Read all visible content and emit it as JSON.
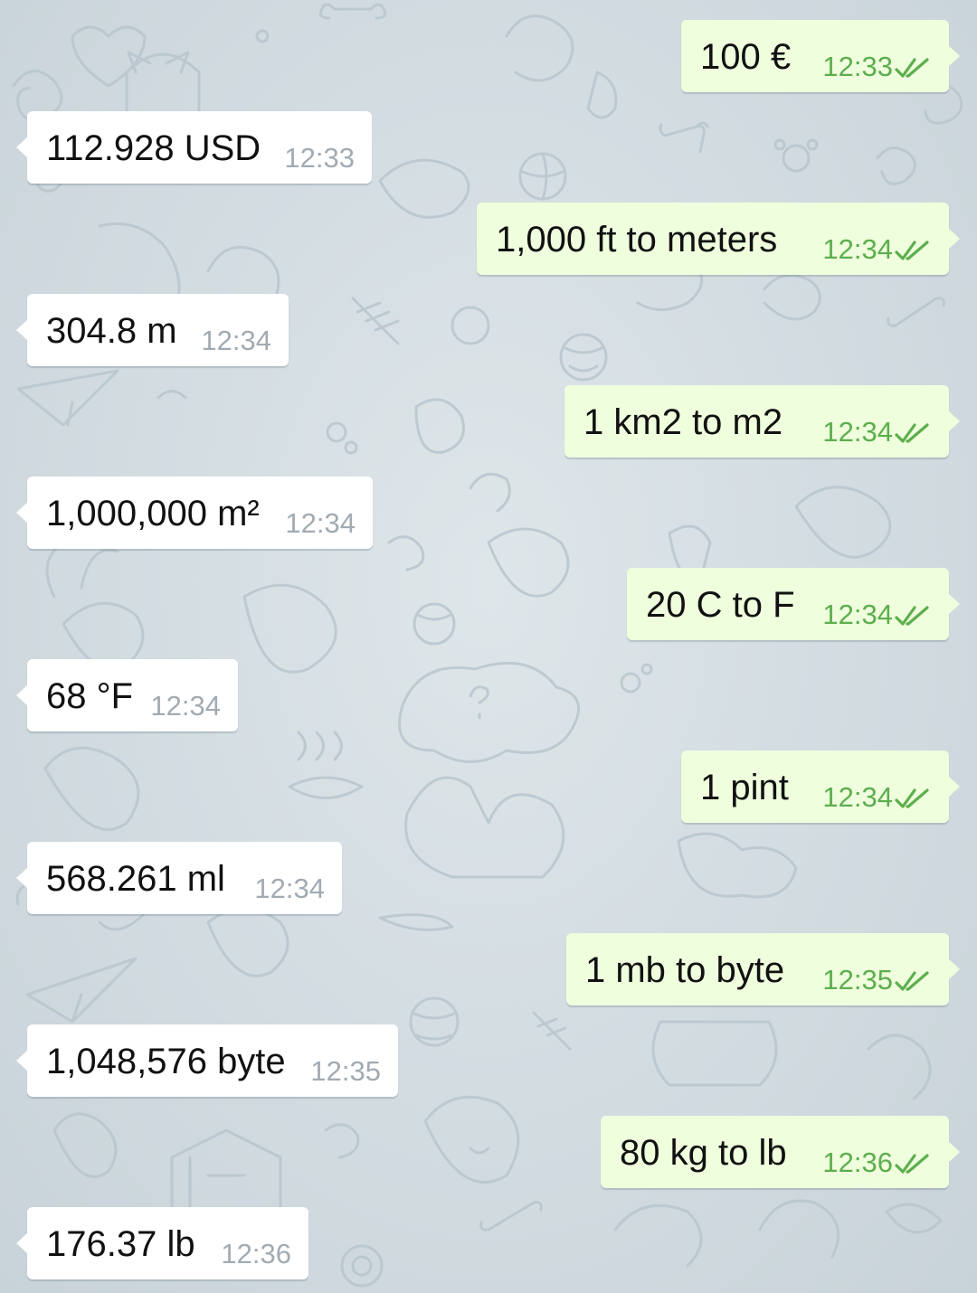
{
  "chat": {
    "messages": [
      {
        "direction": "out",
        "text": "100 €",
        "time": "12:33",
        "status_icon": "double-check-icon"
      },
      {
        "direction": "in",
        "text": "112.928 USD",
        "time": "12:33"
      },
      {
        "direction": "out",
        "text": "1,000 ft to meters",
        "time": "12:34",
        "status_icon": "double-check-icon"
      },
      {
        "direction": "in",
        "text": "304.8 m",
        "time": "12:34"
      },
      {
        "direction": "out",
        "text": "1 km2 to m2",
        "time": "12:34",
        "status_icon": "double-check-icon"
      },
      {
        "direction": "in",
        "text": "1,000,000 m²",
        "time": "12:34"
      },
      {
        "direction": "out",
        "text": "20 C to F",
        "time": "12:34",
        "status_icon": "double-check-icon"
      },
      {
        "direction": "in",
        "text": "68 °F",
        "time": "12:34"
      },
      {
        "direction": "out",
        "text": "1 pint",
        "time": "12:34",
        "status_icon": "double-check-icon"
      },
      {
        "direction": "in",
        "text": "568.261 ml",
        "time": "12:34"
      },
      {
        "direction": "out",
        "text": "1 mb to byte",
        "time": "12:35",
        "status_icon": "double-check-icon"
      },
      {
        "direction": "in",
        "text": "1,048,576 byte",
        "time": "12:35"
      },
      {
        "direction": "out",
        "text": "80 kg to lb",
        "time": "12:36",
        "status_icon": "double-check-icon"
      },
      {
        "direction": "in",
        "text": "176.37 lb",
        "time": "12:36"
      }
    ]
  },
  "colors": {
    "background": "#d0dae0",
    "incoming_bubble": "#ffffff",
    "outgoing_bubble": "#effedd",
    "outgoing_time": "#5dae4e",
    "incoming_time": "#a2abb2",
    "read_check": "#5dae4e"
  }
}
